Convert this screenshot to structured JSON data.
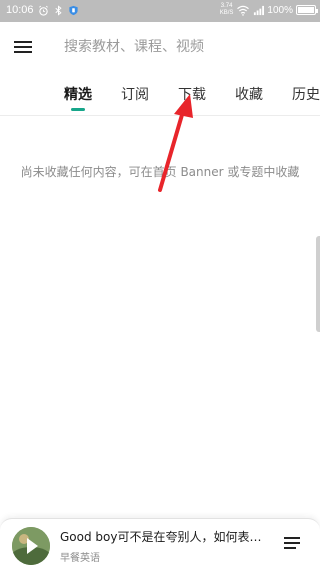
{
  "status_bar": {
    "time": "10:06",
    "net_speed_value": "3.74",
    "net_speed_unit": "KB/S",
    "battery_percent": "100%",
    "battery_level": 1.0
  },
  "header": {
    "search_placeholder": "搜索教材、课程、视频"
  },
  "tabs": [
    {
      "label": "精选",
      "active": true
    },
    {
      "label": "订阅",
      "active": false
    },
    {
      "label": "下载",
      "active": false
    },
    {
      "label": "收藏",
      "active": false
    },
    {
      "label": "历史",
      "active": false
    }
  ],
  "empty_state": {
    "message": "尚未收藏任何内容，可在首页 Banner 或专题中收藏"
  },
  "player": {
    "title": "Good boy可不是在夸别人，如何表…",
    "subtitle": "早餐英语"
  },
  "colors": {
    "accent": "#17a68a",
    "annotation_arrow": "#e8252b",
    "status_bar_bg": "#bcbcbc"
  }
}
